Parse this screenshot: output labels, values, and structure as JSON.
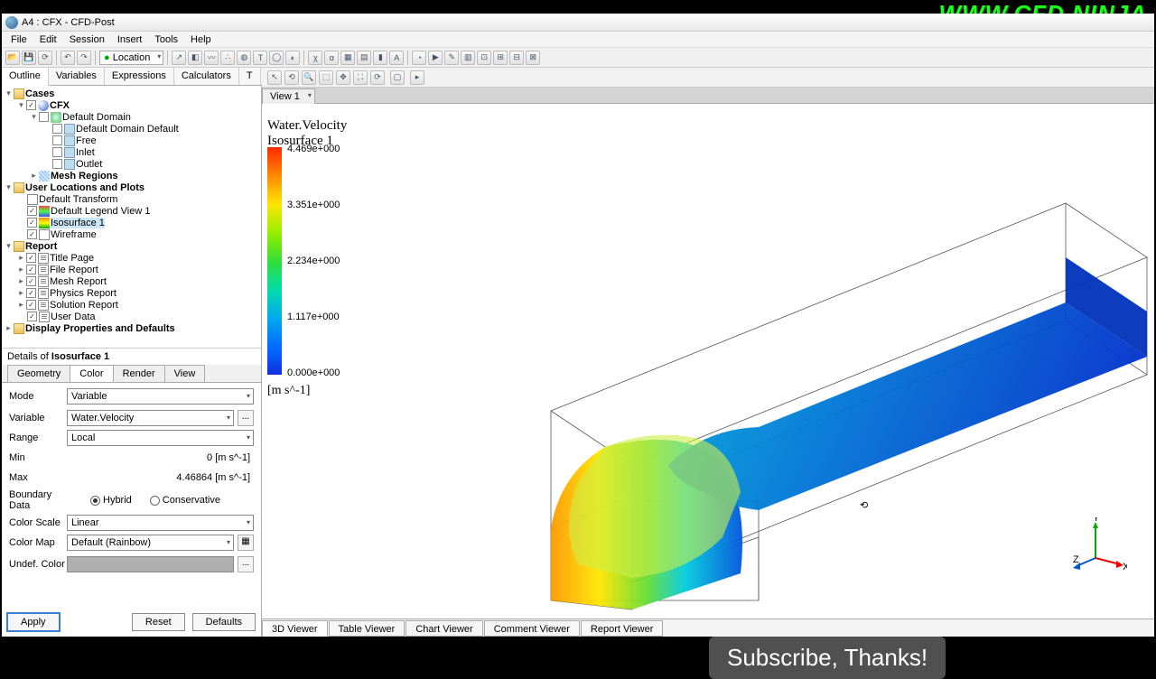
{
  "brand": "WWW.CFD.NINJA",
  "window_title": "A4 : CFX - CFD-Post",
  "menus": [
    "File",
    "Edit",
    "Session",
    "Insert",
    "Tools",
    "Help"
  ],
  "location_label": "Location",
  "side_tabs": {
    "active": "Outline",
    "items": [
      "Outline",
      "Variables",
      "Expressions",
      "Calculators",
      "T"
    ]
  },
  "tree": {
    "cases": "Cases",
    "cfx": "CFX",
    "default_domain": "Default Domain",
    "dd_default": "Default Domain Default",
    "free": "Free",
    "inlet": "Inlet",
    "outlet": "Outlet",
    "mesh_regions": "Mesh Regions",
    "user_loc": "User Locations and Plots",
    "default_transform": "Default Transform",
    "legend": "Default Legend View 1",
    "iso": "Isosurface 1",
    "wire": "Wireframe",
    "report": "Report",
    "title_page": "Title Page",
    "file_report": "File Report",
    "mesh_report": "Mesh Report",
    "physics_report": "Physics Report",
    "solution_report": "Solution Report",
    "user_data": "User Data",
    "display_props": "Display Properties and Defaults"
  },
  "details": {
    "title_prefix": "Details of ",
    "title_object": "Isosurface 1",
    "tabs": [
      "Geometry",
      "Color",
      "Render",
      "View"
    ],
    "active_tab": "Color",
    "mode_label": "Mode",
    "mode_value": "Variable",
    "variable_label": "Variable",
    "variable_value": "Water.Velocity",
    "range_label": "Range",
    "range_value": "Local",
    "min_label": "Min",
    "min_value": "0 [m s^-1]",
    "max_label": "Max",
    "max_value": "4.46864 [m s^-1]",
    "boundary_label": "Boundary Data",
    "hybrid": "Hybrid",
    "conservative": "Conservative",
    "colorscale_label": "Color Scale",
    "colorscale_value": "Linear",
    "colormap_label": "Color Map",
    "colormap_value": "Default (Rainbow)",
    "undef_label": "Undef. Color",
    "apply": "Apply",
    "reset": "Reset",
    "defaults": "Defaults"
  },
  "view": {
    "tab": "View 1",
    "legend_title1": "Water.Velocity",
    "legend_title2": "Isosurface 1",
    "ticks": [
      "4.469e+000",
      "3.351e+000",
      "2.234e+000",
      "1.117e+000",
      "0.000e+000"
    ],
    "units": "[m s^-1]",
    "axes": {
      "x": "X",
      "y": "Y",
      "z": "Z"
    }
  },
  "bottom_tabs": [
    "3D Viewer",
    "Table Viewer",
    "Chart Viewer",
    "Comment Viewer",
    "Report Viewer"
  ],
  "overlay": "Subscribe, Thanks!"
}
